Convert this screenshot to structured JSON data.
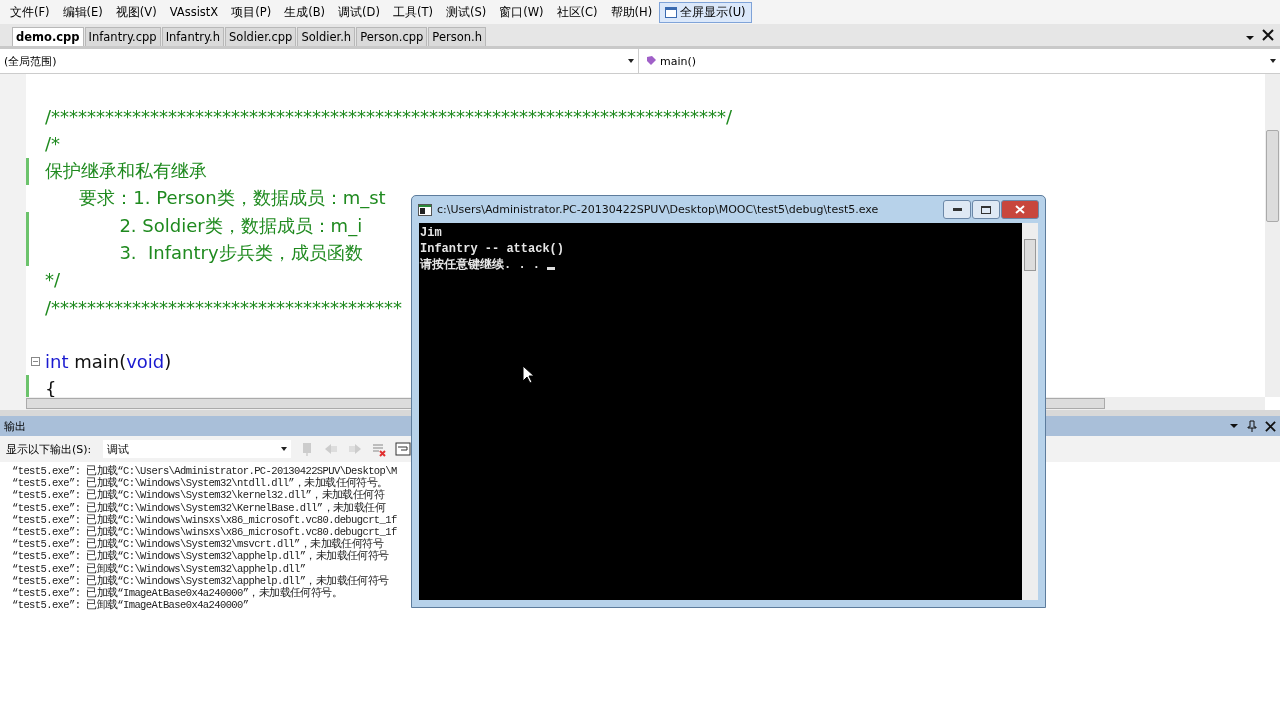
{
  "menu": [
    {
      "label": "文件(F)",
      "selected": false
    },
    {
      "label": "编辑(E)",
      "selected": false
    },
    {
      "label": "视图(V)",
      "selected": false
    },
    {
      "label": "VAssistX",
      "selected": false
    },
    {
      "label": "项目(P)",
      "selected": false
    },
    {
      "label": "生成(B)",
      "selected": false
    },
    {
      "label": "调试(D)",
      "selected": false
    },
    {
      "label": "工具(T)",
      "selected": false
    },
    {
      "label": "测试(S)",
      "selected": false
    },
    {
      "label": "窗口(W)",
      "selected": false
    },
    {
      "label": "社区(C)",
      "selected": false
    },
    {
      "label": "帮助(H)",
      "selected": false
    },
    {
      "label": "全屏显示(U)",
      "selected": true
    }
  ],
  "tabs": [
    {
      "label": "demo.cpp",
      "selected": true
    },
    {
      "label": "Infantry.cpp",
      "selected": false
    },
    {
      "label": "Infantry.h",
      "selected": false
    },
    {
      "label": "Soldier.cpp",
      "selected": false
    },
    {
      "label": "Soldier.h",
      "selected": false
    },
    {
      "label": "Person.cpp",
      "selected": false
    },
    {
      "label": "Person.h",
      "selected": false
    }
  ],
  "nav": {
    "scope": "(全局范围)",
    "member": "main()"
  },
  "editor": {
    "lines": [
      {
        "changed": false,
        "fold": false
      },
      {
        "changed": false,
        "fold": false,
        "tokens": [
          {
            "kind": "comment",
            "text": "/***************************************************************************/"
          }
        ]
      },
      {
        "changed": false,
        "fold": false,
        "tokens": [
          {
            "kind": "comment",
            "text": "/*"
          }
        ]
      },
      {
        "changed": true,
        "fold": false,
        "tokens": [
          {
            "kind": "comment",
            "text": "保护继承和私有继承"
          }
        ]
      },
      {
        "changed": false,
        "fold": false,
        "tokens": [
          {
            "kind": "comment",
            "text": "      要求：1. Person类，数据成员：m_st"
          }
        ]
      },
      {
        "changed": true,
        "fold": false,
        "tokens": [
          {
            "kind": "comment",
            "text": "             2. Soldier类，数据成员：m_i"
          }
        ]
      },
      {
        "changed": true,
        "fold": false,
        "tokens": [
          {
            "kind": "comment",
            "text": "             3.  Infantry步兵类，成员函数"
          }
        ]
      },
      {
        "changed": false,
        "fold": false,
        "tokens": [
          {
            "kind": "comment",
            "text": "*/"
          }
        ]
      },
      {
        "changed": false,
        "fold": false,
        "tokens": [
          {
            "kind": "comment",
            "text": "/***************************************"
          }
        ]
      },
      {
        "changed": false,
        "fold": false
      },
      {
        "changed": false,
        "fold": true,
        "tokens": [
          {
            "kind": "keyword",
            "text": "int"
          },
          {
            "kind": "plain",
            "text": " main("
          },
          {
            "kind": "keyword",
            "text": "void"
          },
          {
            "kind": "plain",
            "text": ")"
          }
        ]
      },
      {
        "changed": true,
        "fold": false,
        "tokens": [
          {
            "kind": "plain",
            "text": "{"
          }
        ]
      }
    ]
  },
  "output": {
    "title": "输出",
    "source_label": "显示以下输出(S):",
    "source": "调试",
    "lines": [
      "“test5.exe”: 已加载“C:\\Users\\Administrator.PC-20130422SPUV\\Desktop\\M",
      "“test5.exe”: 已加载“C:\\Windows\\System32\\ntdll.dll”，未加载任何符号。",
      "“test5.exe”: 已加载“C:\\Windows\\System32\\kernel32.dll”，未加载任何符",
      "“test5.exe”: 已加载“C:\\Windows\\System32\\KernelBase.dll”，未加载任何",
      "“test5.exe”: 已加载“C:\\Windows\\winsxs\\x86_microsoft.vc80.debugcrt_1f",
      "“test5.exe”: 已加载“C:\\Windows\\winsxs\\x86_microsoft.vc80.debugcrt_1f",
      "“test5.exe”: 已加载“C:\\Windows\\System32\\msvcrt.dll”，未加载任何符号",
      "“test5.exe”: 已加载“C:\\Windows\\System32\\apphelp.dll”，未加载任何符号",
      "“test5.exe”: 已卸载“C:\\Windows\\System32\\apphelp.dll”",
      "“test5.exe”: 已加载“C:\\Windows\\System32\\apphelp.dll”，未加载任何符号",
      "“test5.exe”: 已加载“ImageAtBase0x4a240000”，未加载任何符号。",
      "“test5.exe”: 已卸载“ImageAtBase0x4a240000”"
    ]
  },
  "console": {
    "title": "c:\\Users\\Administrator.PC-20130422SPUV\\Desktop\\MOOC\\test5\\debug\\test5.exe",
    "lines": [
      "Jim",
      "Infantry -- attack()",
      "请按任意键继续. . . "
    ]
  }
}
